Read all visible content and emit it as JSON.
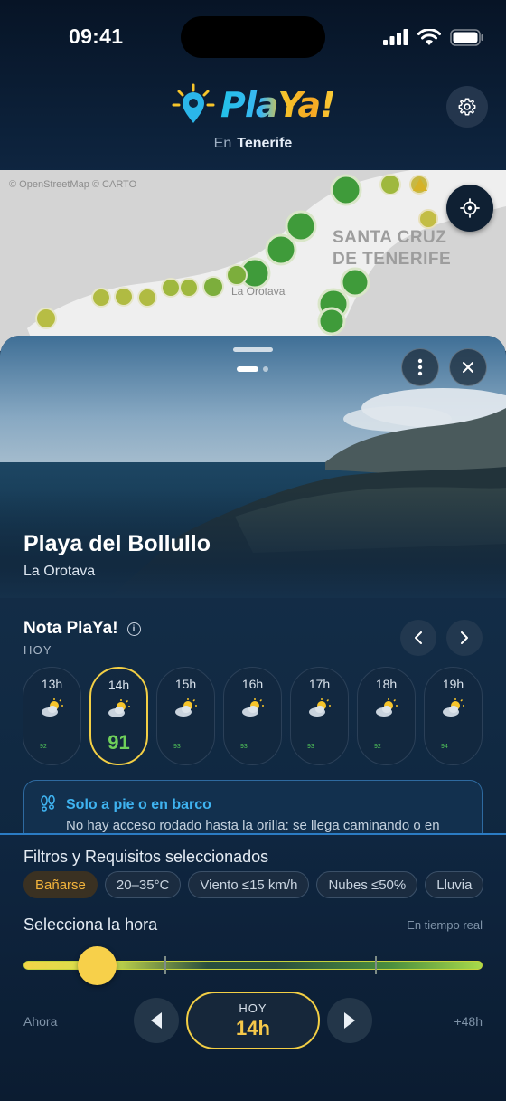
{
  "status_bar": {
    "time": "09:41"
  },
  "header": {
    "app_name": "PlaYa!",
    "region_prefix": "En",
    "region": "Tenerife"
  },
  "map": {
    "attribution": "© OpenStreetMap  © CARTO",
    "city_label_line1": "SANTA CRUZ",
    "city_label_line2": "DE TENERIFE",
    "town_label": "La Orotava"
  },
  "beach": {
    "name": "Playa del Bollullo",
    "municipality": "La Orotava"
  },
  "nota": {
    "title": "Nota PlaYa!",
    "day": "HOY",
    "hours": [
      {
        "label": "13h",
        "score": "92",
        "icon": "partly-cloudy-icon"
      },
      {
        "label": "14h",
        "score": "91",
        "icon": "partly-cloudy-icon",
        "selected": true
      },
      {
        "label": "15h",
        "score": "93",
        "icon": "partly-cloudy-icon"
      },
      {
        "label": "16h",
        "score": "93",
        "icon": "partly-cloudy-icon"
      },
      {
        "label": "17h",
        "score": "93",
        "icon": "partly-cloudy-icon"
      },
      {
        "label": "18h",
        "score": "92",
        "icon": "partly-cloudy-icon"
      },
      {
        "label": "19h",
        "score": "94",
        "icon": "partly-cloudy-icon"
      }
    ]
  },
  "access": {
    "title": "Solo a pie o en barco",
    "text": "No hay acceso rodado hasta la orilla: se llega caminando o en"
  },
  "filters": {
    "title": "Filtros y Requisitos seleccionados",
    "chips": [
      "Bañarse",
      "20–35°C",
      "Viento ≤15 km/h",
      "Nubes ≤50%",
      "Lluvia"
    ]
  },
  "time_selector": {
    "title": "Selecciona la hora",
    "realtime_label": "En tiempo real",
    "start_label": "Ahora",
    "end_label": "+48h",
    "selected_day": "HOY",
    "selected_hour": "14h",
    "slider_fraction": 0.12
  },
  "colors": {
    "accent_yellow": "#f3cf45",
    "score_green": "#6fd05a",
    "access_blue": "#3fb3f0",
    "chip_active": "#f3b43c"
  }
}
